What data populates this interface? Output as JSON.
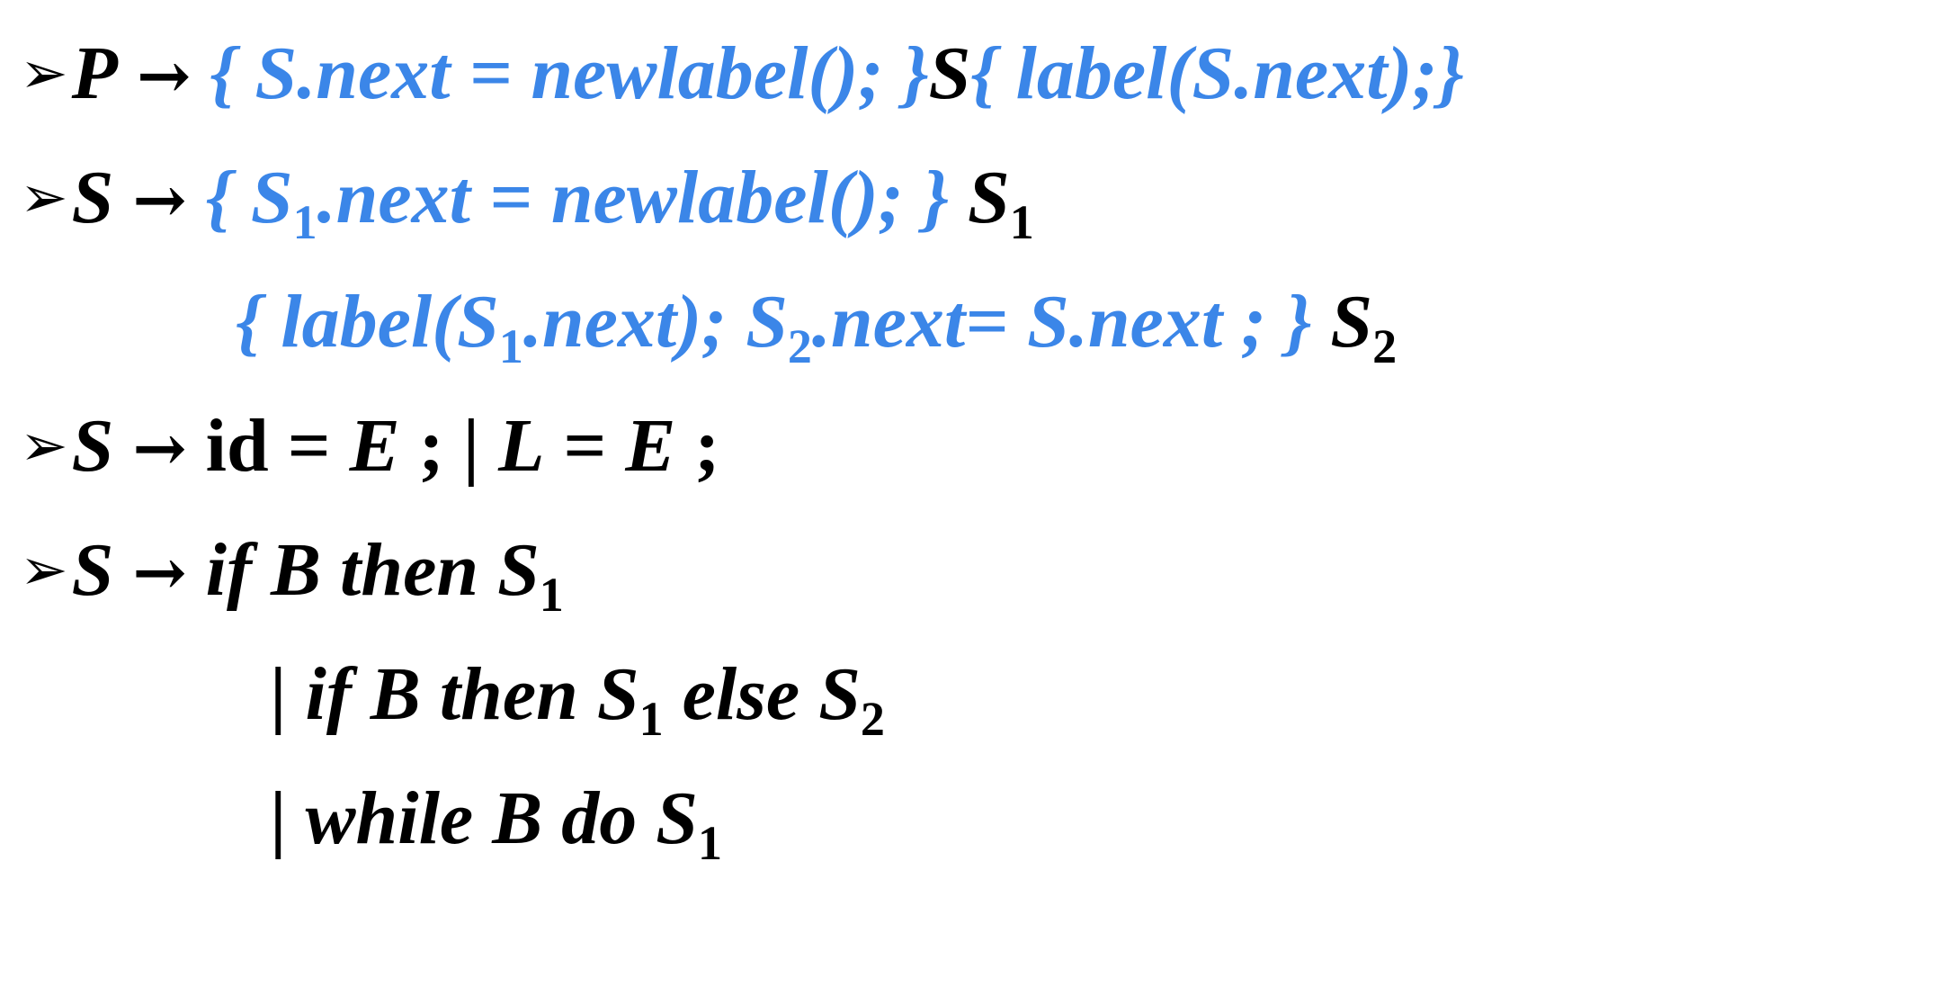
{
  "colors": {
    "blue": "#3b86e8",
    "black": "#000000"
  },
  "bullet_icon": "arrowhead-bullet",
  "lines": {
    "l1": {
      "bullet": "➢",
      "head": "P",
      "arrow": "→",
      "action1": "{ S.next = newlabel(); }",
      "nonterm": "S",
      "action2": "{ label(S.next);}"
    },
    "l2": {
      "bullet": "➢",
      "head": "S",
      "arrow": "→",
      "action_pre": "{ S",
      "action_sub": "1",
      "action_post": ".next = newlabel(); }",
      "nonterm": "S",
      "nonterm_sub": "1"
    },
    "l3": {
      "a": "{ label(S",
      "a_sub": "1",
      "b": ".next); S",
      "b_sub": "2",
      "c": ".next= S.next ; }",
      "nonterm": "S",
      "nonterm_sub": "2"
    },
    "l4": {
      "bullet": "➢",
      "head": "S",
      "arrow": "→",
      "id": "id",
      "rest1": " = ",
      "e1": "E",
      "rest2": " ; | ",
      "l": "L",
      "rest3": " = ",
      "e2": "E",
      "rest4": " ;"
    },
    "l5": {
      "bullet": "➢",
      "head": "S",
      "arrow": "→",
      "text": "if B then S",
      "sub": "1"
    },
    "l6": {
      "bar": "| ",
      "text1": "if B then S",
      "sub1": "1",
      "text2": " else S",
      "sub2": "2"
    },
    "l7": {
      "bar": "| ",
      "text": "while B do S",
      "sub": "1"
    }
  }
}
